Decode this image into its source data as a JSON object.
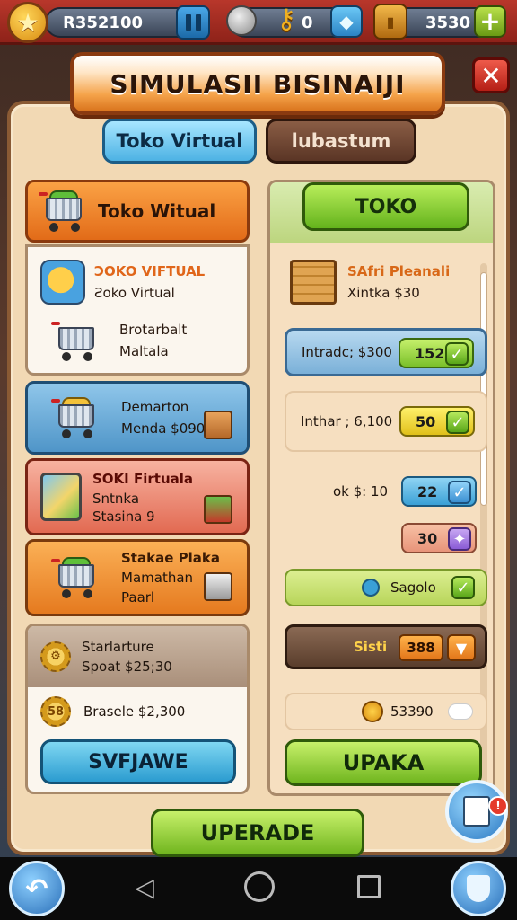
{
  "topbar": {
    "money": "R352100",
    "keys": "0",
    "gold": "3530"
  },
  "title": "SIMULASII BISINAIJI",
  "tabs": [
    {
      "label": "Toko Virtual",
      "active": true
    },
    {
      "label": "lubastum",
      "active": false
    }
  ],
  "left": {
    "header": "Toko Witual",
    "card1": {
      "line1": "ƆOKO VIFTUAL",
      "line2": "Ƨoko Virtual",
      "line3": "Brotarbalt",
      "line4": "Maltala"
    },
    "blue_card": {
      "line1": "Demarton",
      "line2": "Menda $090"
    },
    "red_card": {
      "line1": "SOKI Firtuala",
      "line2": "Sntnka",
      "line3": "Stasina 9"
    },
    "orange_card": {
      "line1": "Stakae Plaka",
      "line2": "Mamathan",
      "line3": "Paarl"
    },
    "bottom": {
      "head_line1": "Starlarture",
      "head_line2": "Spoat $25;30",
      "row_text": "Brasele $2,300",
      "button": "SVFJAWE"
    }
  },
  "right": {
    "top_button": "TOKO",
    "shop_line1": "SAfri Pleanali",
    "shop_line2": "Xintka $30",
    "rows": [
      {
        "label": "Intradc; $300",
        "value": "152"
      },
      {
        "label": "Inthar ; 6,100",
        "value": "50"
      },
      {
        "label": "ok $: 10",
        "value": "22"
      },
      {
        "label": "",
        "value": "30"
      }
    ],
    "lime_row": "Sagolo",
    "brown_row": {
      "label": "Sisti",
      "value": "388"
    },
    "cream_row": "53390",
    "button": "UPAKA"
  },
  "upgrade_button": "UPERADE",
  "colors": {
    "panel": "#f2d9b4",
    "accent_orange": "#e26b18",
    "accent_green": "#70b51e",
    "accent_blue": "#2b9cd0",
    "topbar_red": "#b8372b"
  }
}
